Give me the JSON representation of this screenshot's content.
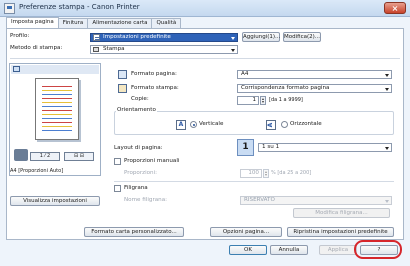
{
  "window": {
    "title": "Preferenze stampa - Canon Printer",
    "close_glyph": "×"
  },
  "tabs": [
    "Imposta pagina",
    "Finitura",
    "Alimentazione carta",
    "Qualità"
  ],
  "profile": {
    "label": "Profilo:",
    "value": "Impostazioni predefinite",
    "add_button": "Aggiungi(1)...",
    "edit_button": "Modifica(2)..."
  },
  "output_method": {
    "label": "Metodo di stampa:",
    "value": "Stampa"
  },
  "page_setup": {
    "page_size_label": "Formato pagina:",
    "page_size_value": "A4",
    "output_size_label": "Formato stampa:",
    "output_size_value": "Corrispondenza formato pagina",
    "copies_label": "Copie:",
    "copies_value": "1",
    "copies_range": "[da 1 a 9999]",
    "orientation_label": "Orientamento",
    "portrait_label": "Verticale",
    "landscape_label": "Orizzontale"
  },
  "preview": {
    "caption": "A4 [Proporzioni Auto]",
    "show_settings_button": "Visualizza impostazioni"
  },
  "layout": {
    "label": "Layout di pagina:",
    "value": "1 su 1",
    "icon_text": "1",
    "manual_scaling_label": "Proporzioni manuali",
    "scaling_label": "Proporzioni:",
    "scaling_value": "100",
    "scaling_range": "% [da 25 a 200]"
  },
  "watermark": {
    "label": "Filigrana",
    "name_label": "Nome filigrana:",
    "name_value": "RISERVATO",
    "edit_button": "Modifica filigrana..."
  },
  "bottom_buttons": {
    "custom_size": "Formato carta personalizzato...",
    "page_options": "Opzioni pagina...",
    "restore_defaults": "Ripristina impostazioni predefinite"
  },
  "dialog_buttons": {
    "ok": "OK",
    "cancel": "Annulla",
    "apply": "Applica",
    "help": "?"
  }
}
